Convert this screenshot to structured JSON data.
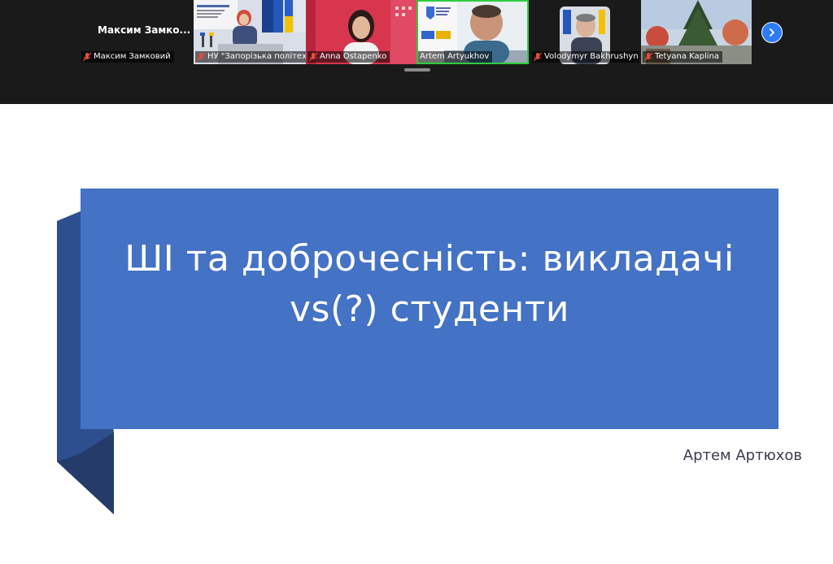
{
  "participants_strip": {
    "pinned_name": "Максим  Замко...",
    "tiles": [
      {
        "name": "Максим Замковий",
        "muted": true
      },
      {
        "name": "НУ \"Запорізька політех...",
        "muted": true
      },
      {
        "name": "Anna Ostapenko",
        "muted": true
      },
      {
        "name": "Artem Artyukhov",
        "muted": false,
        "active_speaker": true
      },
      {
        "name": "Volodymyr Bakhrushyn",
        "muted": true
      },
      {
        "name": "Tetyana Kaplina",
        "muted": true
      }
    ],
    "next_page_icon": "chevron-right-icon",
    "colors": {
      "active_border": "#2ecc40",
      "strip_bg": "#1a1a1a",
      "scroll_button": "#2d7cf6"
    }
  },
  "slide": {
    "title_line1": "ШІ та доброчесність: викладачі",
    "title_line2": "vs(?) студенти",
    "author": "Артем Артюхов",
    "colors": {
      "banner": "#4472c4",
      "ribbon_fold": "#2e4f8f",
      "ribbon_tail": "#253c6b"
    }
  }
}
